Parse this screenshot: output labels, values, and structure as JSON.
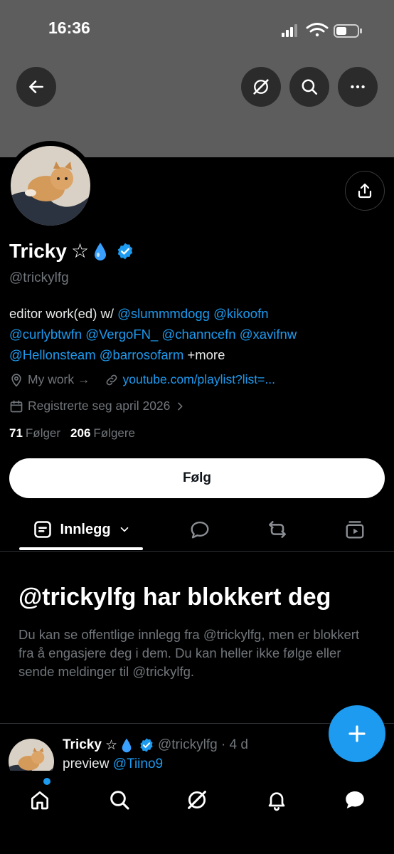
{
  "status_bar": {
    "time": "16:36"
  },
  "header": {
    "back_icon": "arrow-left-icon",
    "grok_icon": "slash-circle-icon",
    "search_icon": "search-icon",
    "more_icon": "more-horizontal-icon"
  },
  "profile": {
    "name": "Tricky",
    "name_symbols": "☆",
    "drop_emoji": "💧",
    "handle": "@trickylfg",
    "bio": {
      "prefix": "editor work(ed) w/",
      "mentions": [
        "@slummmdogg",
        "@kikoofn",
        "@curlybtwfn",
        "@VergoFN_",
        "@channcefn",
        "@xavifnw",
        "@Hellonsteam",
        "@barrosofarm"
      ],
      "suffix": "+more"
    },
    "location": "My work →",
    "website": "youtube.com/playlist?list=...",
    "joined": "Registrerte seg april 2026",
    "following_count": "71",
    "following_label": "Følger",
    "followers_count": "206",
    "followers_label": "Følgere",
    "follow_button": "Følg"
  },
  "tabs": {
    "active_label": "Innlegg",
    "items": [
      "Innlegg",
      "replies",
      "reposts",
      "media"
    ]
  },
  "blocked": {
    "title": "@trickylfg har blokkert deg",
    "text": "Du kan se offentlige innlegg fra @trickylfg, men er blokkert fra å engasjere deg i dem. Du kan heller ikke følge eller sende meldinger til @trickylfg."
  },
  "post": {
    "name": "Tricky",
    "symbols": "☆",
    "emoji": "💧",
    "handle_time": "@trickylfg · 4 d",
    "body_prefix": "preview",
    "body_mention": "@Tiino9"
  },
  "colors": {
    "accent": "#1d9bf0",
    "banner": "#5d5d5d",
    "background": "#000000",
    "secondary_text": "#71767b"
  },
  "bottom_nav": [
    "home-icon",
    "search-icon",
    "grok-icon",
    "bell-icon",
    "messages-icon"
  ]
}
